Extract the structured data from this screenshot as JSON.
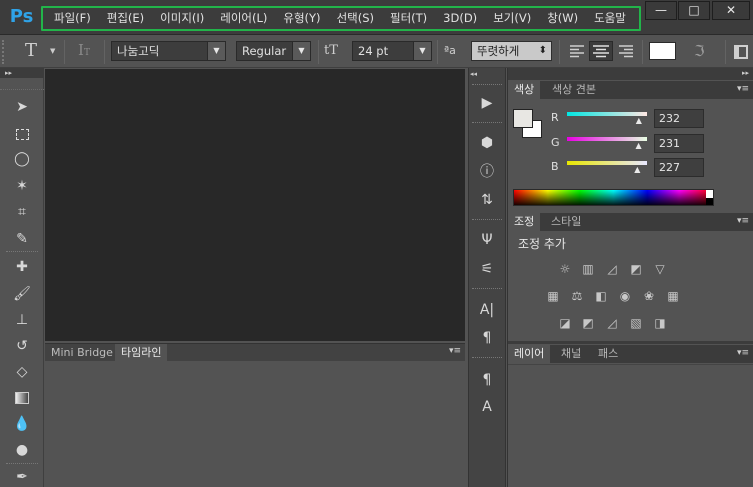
{
  "app": {
    "logo": "Ps"
  },
  "menu": {
    "items": [
      "파일(F)",
      "편집(E)",
      "이미지(I)",
      "레이어(L)",
      "유형(Y)",
      "선택(S)",
      "필터(T)",
      "3D(D)",
      "보기(V)",
      "창(W)",
      "도움말"
    ]
  },
  "window_controls": {
    "minimize": "—",
    "maximize": "□",
    "close": "✕"
  },
  "options": {
    "tool_glyph": "T",
    "font_family": "나눔고딕",
    "font_style": "Regular",
    "font_size": "24 pt",
    "aa_glyph": "ªa",
    "antialias": "뚜렷하게",
    "size_glyph": "tT",
    "dd_arrow": "▼",
    "updown": "⬍"
  },
  "toolbar": {
    "grip": "▸▸"
  },
  "bottom_panel": {
    "tabs": [
      "Mini Bridge",
      "타임라인"
    ],
    "active": 1
  },
  "color_panel": {
    "tabs": [
      "색상",
      "색상 견본"
    ],
    "r_label": "R",
    "g_label": "G",
    "b_label": "B",
    "r": 232,
    "g": 231,
    "b": 227,
    "foreground": "#e8e7e3",
    "background": "#ffffff"
  },
  "adjust_panel": {
    "tabs": [
      "조정",
      "스타일"
    ],
    "title": "조정 추가"
  },
  "layers_panel": {
    "tabs": [
      "레이어",
      "채널",
      "패스"
    ]
  },
  "panel_menu": "▾≡",
  "collapse": "◂◂",
  "colors": {
    "accent_highlight": "#22b44a",
    "ps_blue": "#2fa3e8"
  }
}
